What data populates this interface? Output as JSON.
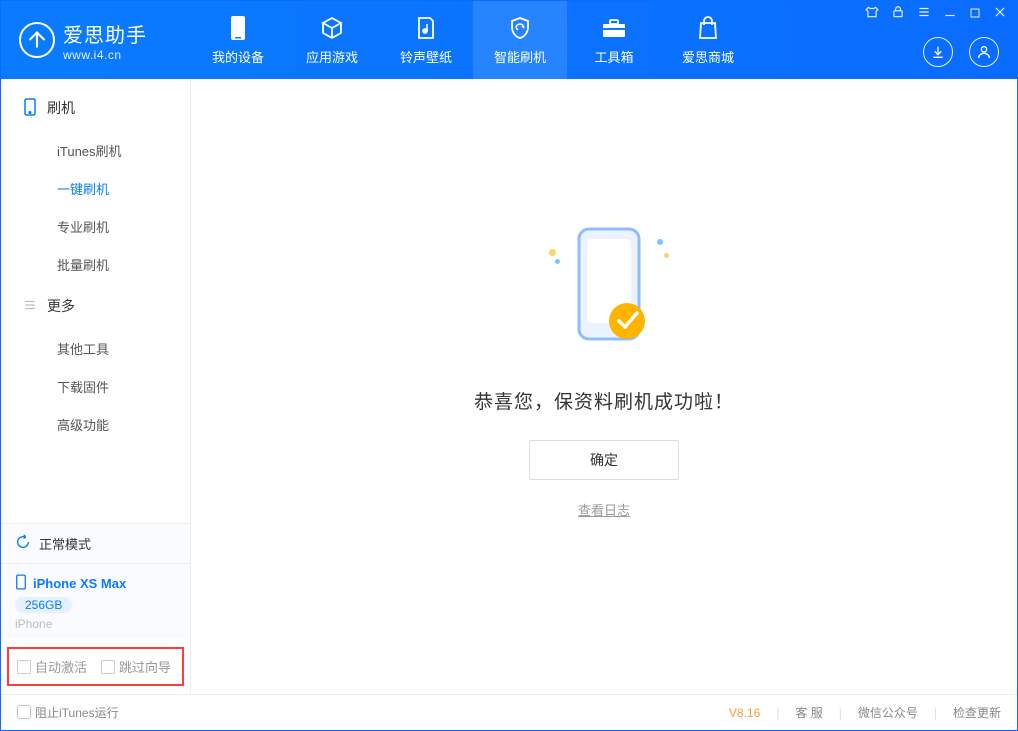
{
  "app": {
    "name_cn": "爱思助手",
    "name_en": "www.i4.cn"
  },
  "nav": [
    {
      "label": "我的设备"
    },
    {
      "label": "应用游戏"
    },
    {
      "label": "铃声壁纸"
    },
    {
      "label": "智能刷机"
    },
    {
      "label": "工具箱"
    },
    {
      "label": "爱思商城"
    }
  ],
  "sidebar": {
    "groups": [
      {
        "title": "刷机",
        "items": [
          {
            "label": "iTunes刷机"
          },
          {
            "label": "一键刷机",
            "active": true
          },
          {
            "label": "专业刷机"
          },
          {
            "label": "批量刷机"
          }
        ]
      },
      {
        "title": "更多",
        "items": [
          {
            "label": "其他工具"
          },
          {
            "label": "下载固件"
          },
          {
            "label": "高级功能"
          }
        ]
      }
    ],
    "mode_label": "正常模式",
    "device": {
      "name": "iPhone XS Max",
      "storage": "256GB",
      "type": "iPhone"
    },
    "auto_activate_label": "自动激活",
    "skip_guide_label": "跳过向导"
  },
  "main": {
    "success_msg": "恭喜您，保资料刷机成功啦！",
    "ok_label": "确定",
    "log_link": "查看日志"
  },
  "footer": {
    "stop_itunes": "阻止iTunes运行",
    "version": "V8.16",
    "support": "客 服",
    "wechat": "微信公众号",
    "check_update": "检查更新"
  }
}
